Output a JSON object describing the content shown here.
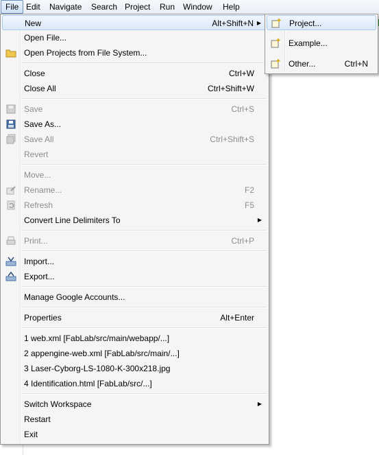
{
  "menubar": {
    "items": [
      "File",
      "Edit",
      "Navigate",
      "Search",
      "Project",
      "Run",
      "Window",
      "Help"
    ]
  },
  "file_menu": {
    "new": {
      "label": "New",
      "shortcut": "Alt+Shift+N"
    },
    "open_file": {
      "label": "Open File..."
    },
    "open_projects": {
      "label": "Open Projects from File System..."
    },
    "close": {
      "label": "Close",
      "shortcut": "Ctrl+W"
    },
    "close_all": {
      "label": "Close All",
      "shortcut": "Ctrl+Shift+W"
    },
    "save": {
      "label": "Save",
      "shortcut": "Ctrl+S"
    },
    "save_as": {
      "label": "Save As..."
    },
    "save_all": {
      "label": "Save All",
      "shortcut": "Ctrl+Shift+S"
    },
    "revert": {
      "label": "Revert"
    },
    "move": {
      "label": "Move..."
    },
    "rename": {
      "label": "Rename...",
      "shortcut": "F2"
    },
    "refresh": {
      "label": "Refresh",
      "shortcut": "F5"
    },
    "convert": {
      "label": "Convert Line Delimiters To"
    },
    "print": {
      "label": "Print...",
      "shortcut": "Ctrl+P"
    },
    "import": {
      "label": "Import..."
    },
    "export": {
      "label": "Export..."
    },
    "manage_google": {
      "label": "Manage Google Accounts..."
    },
    "properties": {
      "label": "Properties",
      "shortcut": "Alt+Enter"
    },
    "recent": [
      "1 web.xml  [FabLab/src/main/webapp/...]",
      "2 appengine-web.xml  [FabLab/src/main/...]",
      "3 Laser-Cyborg-LS-1080-K-300x218.jpg",
      "4 Identification.html  [FabLab/src/...]"
    ],
    "switch_workspace": {
      "label": "Switch Workspace"
    },
    "restart": {
      "label": "Restart"
    },
    "exit": {
      "label": "Exit"
    }
  },
  "new_submenu": {
    "project": {
      "label": "Project..."
    },
    "example": {
      "label": "Example..."
    },
    "other": {
      "label": "Other...",
      "shortcut": "Ctrl+N"
    }
  },
  "colors": {
    "highlight": "#dbe8f9",
    "disabled_text": "#8d8d8d",
    "menu_bg": "#f5f5f5"
  }
}
